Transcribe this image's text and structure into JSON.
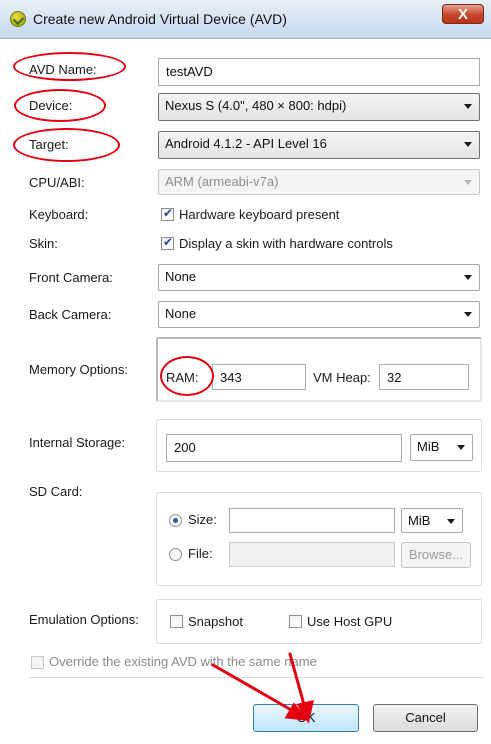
{
  "window": {
    "title": "Create new Android Virtual Device (AVD)",
    "close_glyph": "X"
  },
  "form": {
    "avd_name": {
      "label": "AVD Name:",
      "value": "testAVD"
    },
    "device": {
      "label": "Device:",
      "value": "Nexus S (4.0\", 480 × 800: hdpi)"
    },
    "target": {
      "label": "Target:",
      "value": "Android 4.1.2 - API Level 16"
    },
    "cpu_abi": {
      "label": "CPU/ABI:",
      "value": "ARM (armeabi-v7a)"
    },
    "keyboard": {
      "label": "Keyboard:",
      "checkbox_label": "Hardware keyboard present",
      "checked": true
    },
    "skin": {
      "label": "Skin:",
      "checkbox_label": "Display a skin with hardware controls",
      "checked": true
    },
    "front_camera": {
      "label": "Front Camera:",
      "value": "None"
    },
    "back_camera": {
      "label": "Back Camera:",
      "value": "None"
    },
    "memory": {
      "label": "Memory Options:",
      "ram_label": "RAM:",
      "ram_value": "343",
      "vm_heap_label": "VM Heap:",
      "vm_heap_value": "32"
    },
    "internal_storage": {
      "label": "Internal Storage:",
      "value": "200",
      "unit": "MiB"
    },
    "sd_card": {
      "label": "SD Card:",
      "size_label": "Size:",
      "size_value": "",
      "size_unit": "MiB",
      "file_label": "File:",
      "file_value": "",
      "browse_label": "Browse..."
    },
    "emulation": {
      "label": "Emulation Options:",
      "snapshot_label": "Snapshot",
      "host_gpu_label": "Use Host GPU"
    },
    "override": {
      "label": "Override the existing AVD with the same name"
    }
  },
  "buttons": {
    "ok": "OK",
    "cancel": "Cancel"
  },
  "annotations": {
    "highlight_color": "#e3000f"
  }
}
